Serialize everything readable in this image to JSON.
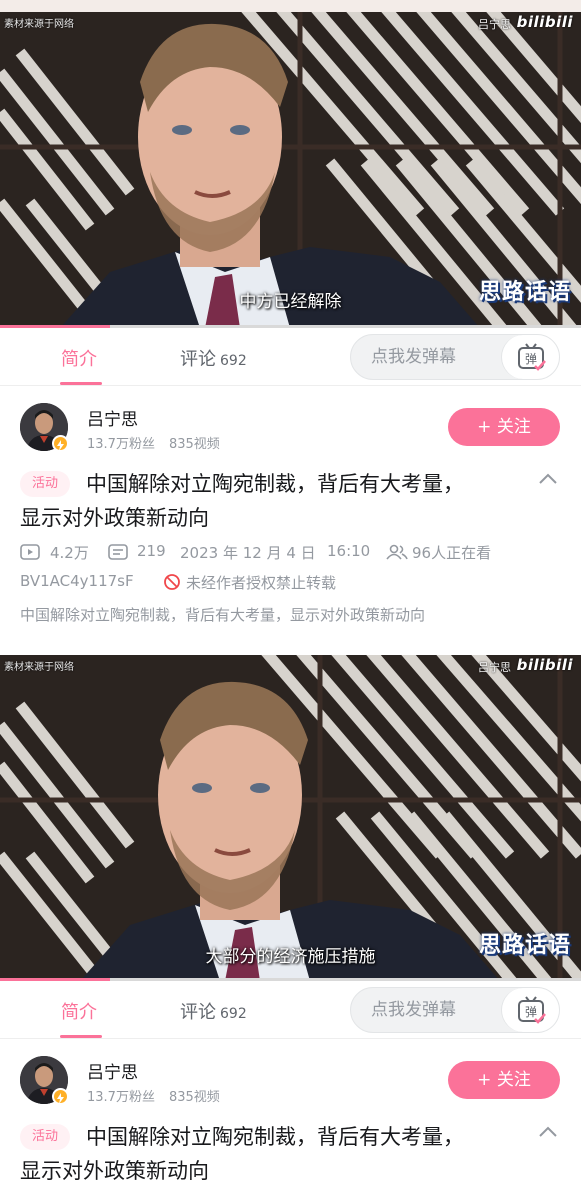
{
  "frame_a": {
    "source_note": "素材来源于网络",
    "uploader_watermark": "吕宁思",
    "platform_logo": "bilibili",
    "channel_logo": "思路话语",
    "subtitle": "中方已经解除",
    "progress_fraction": 0.19
  },
  "frame_b": {
    "source_note": "素材来源于网络",
    "uploader_watermark": "吕宁思",
    "platform_logo": "bilibili",
    "channel_logo": "思路话语",
    "subtitle": "大部分的经济施压措施",
    "progress_fraction": 0.19
  },
  "tabs": {
    "intro": "简介",
    "comments": "评论",
    "comments_count": "692"
  },
  "danmaku": {
    "placeholder": "点我发弹幕",
    "toggle_label": "弹"
  },
  "author": {
    "name": "吕宁思",
    "followers": "13.7万粉丝",
    "videos": "835视频",
    "follow_label": "+ 关注"
  },
  "video": {
    "tag": "活动",
    "title_line1": "中国解除对立陶宛制裁，背后有大考量，",
    "title_line2": "显示对外政策新动向",
    "views": "4.2万",
    "danmaku_count": "219",
    "date": "2023 年 12 月 4 日",
    "time": "16:10",
    "watching": "96人正在看",
    "bvid": "BV1AC4y117sF",
    "no_repost": "未经作者授权禁止转载",
    "description": "中国解除对立陶宛制裁，背后有大考量，显示对外政策新动向"
  },
  "colors": {
    "accent": "#fb7299",
    "text_primary": "#18191c",
    "text_secondary": "#9499a0",
    "verify_badge": "#ffb027"
  },
  "icons": {
    "views": "play-count-icon",
    "danmaku": "danmaku-count-icon",
    "watching": "watching-people-icon",
    "no_repost": "no-repost-icon",
    "collapse": "chevron-up-icon",
    "verify": "verified-badge-icon"
  }
}
